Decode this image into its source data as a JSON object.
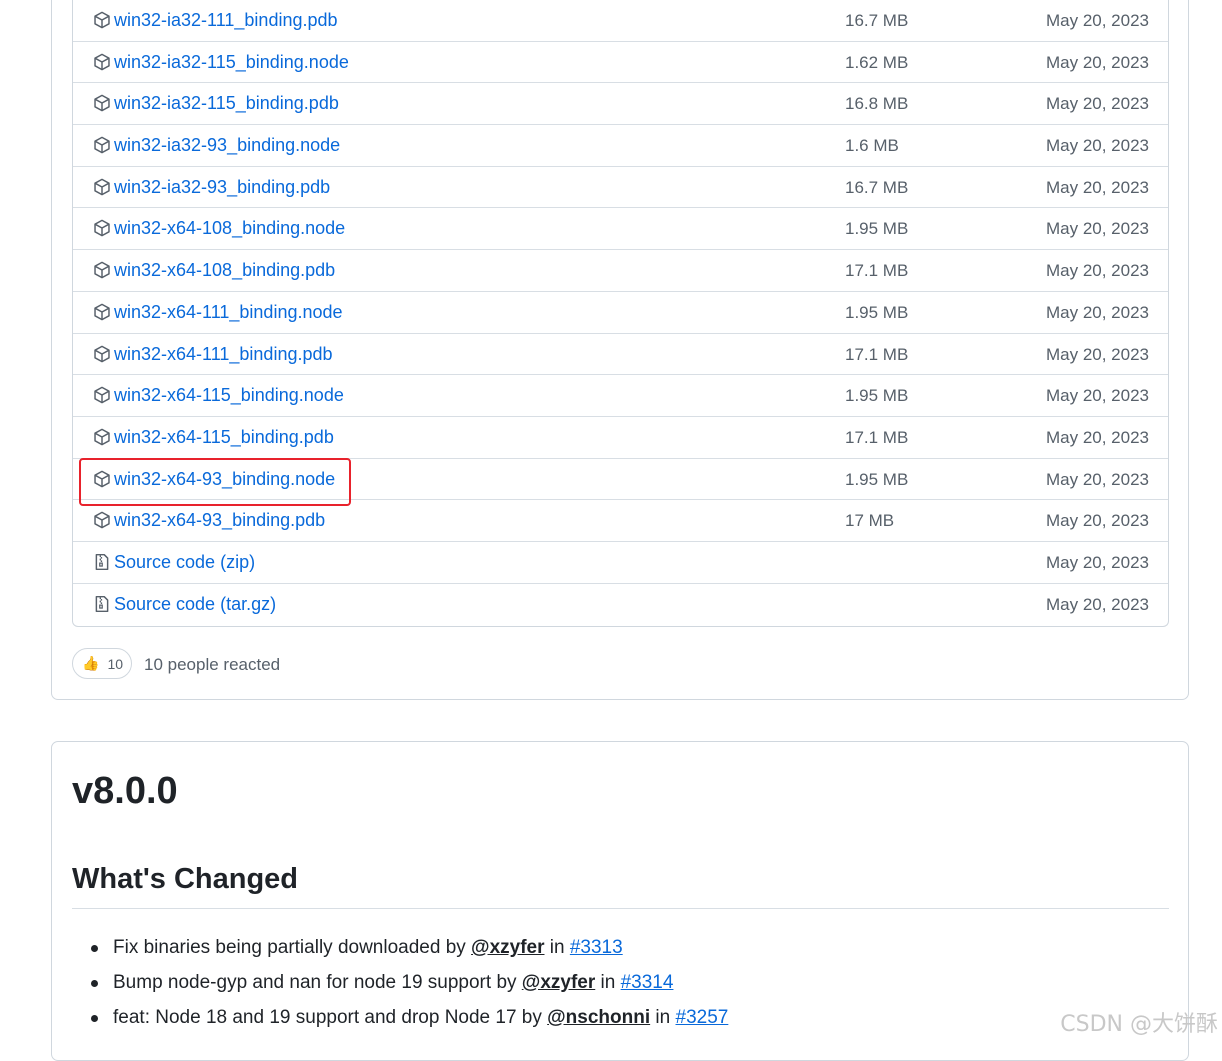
{
  "assets": [
    {
      "name": "win32-ia32-111_binding.pdb",
      "size": "16.7 MB",
      "date": "May 20, 2023",
      "icon": "package-icon"
    },
    {
      "name": "win32-ia32-115_binding.node",
      "size": "1.62 MB",
      "date": "May 20, 2023",
      "icon": "package-icon"
    },
    {
      "name": "win32-ia32-115_binding.pdb",
      "size": "16.8 MB",
      "date": "May 20, 2023",
      "icon": "package-icon"
    },
    {
      "name": "win32-ia32-93_binding.node",
      "size": "1.6 MB",
      "date": "May 20, 2023",
      "icon": "package-icon"
    },
    {
      "name": "win32-ia32-93_binding.pdb",
      "size": "16.7 MB",
      "date": "May 20, 2023",
      "icon": "package-icon"
    },
    {
      "name": "win32-x64-108_binding.node",
      "size": "1.95 MB",
      "date": "May 20, 2023",
      "icon": "package-icon"
    },
    {
      "name": "win32-x64-108_binding.pdb",
      "size": "17.1 MB",
      "date": "May 20, 2023",
      "icon": "package-icon"
    },
    {
      "name": "win32-x64-111_binding.node",
      "size": "1.95 MB",
      "date": "May 20, 2023",
      "icon": "package-icon"
    },
    {
      "name": "win32-x64-111_binding.pdb",
      "size": "17.1 MB",
      "date": "May 20, 2023",
      "icon": "package-icon"
    },
    {
      "name": "win32-x64-115_binding.node",
      "size": "1.95 MB",
      "date": "May 20, 2023",
      "icon": "package-icon"
    },
    {
      "name": "win32-x64-115_binding.pdb",
      "size": "17.1 MB",
      "date": "May 20, 2023",
      "icon": "package-icon"
    },
    {
      "name": "win32-x64-93_binding.node",
      "size": "1.95 MB",
      "date": "May 20, 2023",
      "icon": "package-icon",
      "highlighted": true
    },
    {
      "name": "win32-x64-93_binding.pdb",
      "size": "17 MB",
      "date": "May 20, 2023",
      "icon": "package-icon"
    },
    {
      "name": "Source code",
      "ext": "(zip)",
      "size": "",
      "date": "May 20, 2023",
      "icon": "file-zip-icon"
    },
    {
      "name": "Source code",
      "ext": "(tar.gz)",
      "size": "",
      "date": "May 20, 2023",
      "icon": "file-zip-icon"
    }
  ],
  "reactions": {
    "emoji": "👍",
    "count": "10",
    "summary": "10 people reacted"
  },
  "release": {
    "version": "v8.0.0",
    "section_title": "What's Changed",
    "changes": [
      {
        "text": "Fix binaries being partially downloaded by ",
        "user": "@xzyfer",
        "mid": " in ",
        "pr": "#3313"
      },
      {
        "text": "Bump node-gyp and nan for node 19 support by ",
        "user": "@xzyfer",
        "mid": " in ",
        "pr": "#3314"
      },
      {
        "text": "feat: Node 18 and 19 support and drop Node 17 by ",
        "user": "@nschonni",
        "mid": " in ",
        "pr": "#3257"
      }
    ]
  },
  "watermark": "CSDN @大饼酥",
  "colors": {
    "link": "#0969da",
    "muted": "#57606a",
    "border": "#d0d7de",
    "highlight": "#e8222c"
  }
}
